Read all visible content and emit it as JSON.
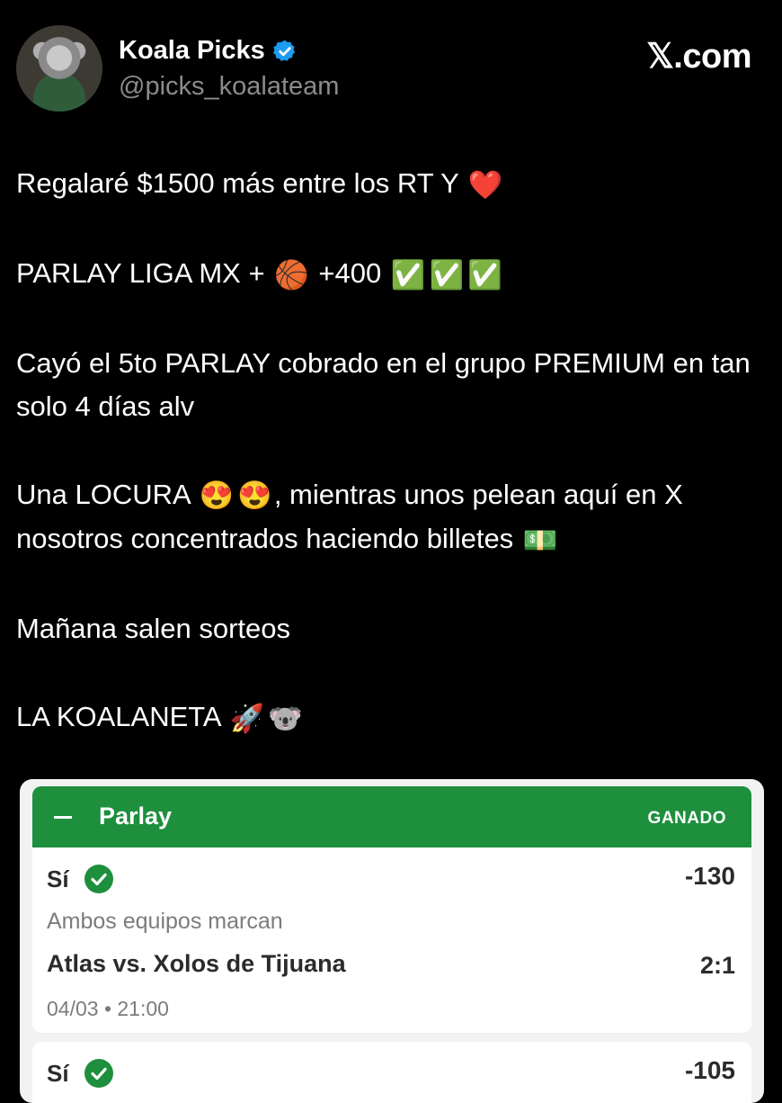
{
  "header": {
    "name": "Koala Picks",
    "handle": "@picks_koalateam",
    "brand": "𝕏.com"
  },
  "tweet": {
    "line1": "Regalaré $1500 más entre los RT Y",
    "line2_text": "PARLAY LIGA MX +",
    "line2_odds": "+400",
    "line3": "Cayó el 5to PARLAY cobrado en el grupo PREMIUM en tan solo 4 días alv",
    "line4_a": "Una LOCURA",
    "line4_b": ", mientras unos pelean aquí en X nosotros concentrados haciendo billetes",
    "line5": "Mañana salen sorteos",
    "line6": "LA KOALANETA",
    "emojis": {
      "heart": "❤️",
      "basketball": "🏀",
      "check": "✅",
      "heart_eyes": "😍",
      "money": "💵",
      "rocket": "🚀",
      "koala": "🐨"
    }
  },
  "card": {
    "title": "Parlay",
    "status": "GANADO",
    "bets": [
      {
        "pick": "Sí",
        "odds": "-130",
        "market": "Ambos equipos marcan",
        "match": "Atlas vs. Xolos de Tijuana",
        "score": "2:1",
        "date": "04/03 • 21:00"
      },
      {
        "pick": "Sí",
        "odds": "-105"
      }
    ]
  },
  "colors": {
    "accent_green": "#1d8f3d",
    "verified_blue": "#1d9bf0"
  }
}
